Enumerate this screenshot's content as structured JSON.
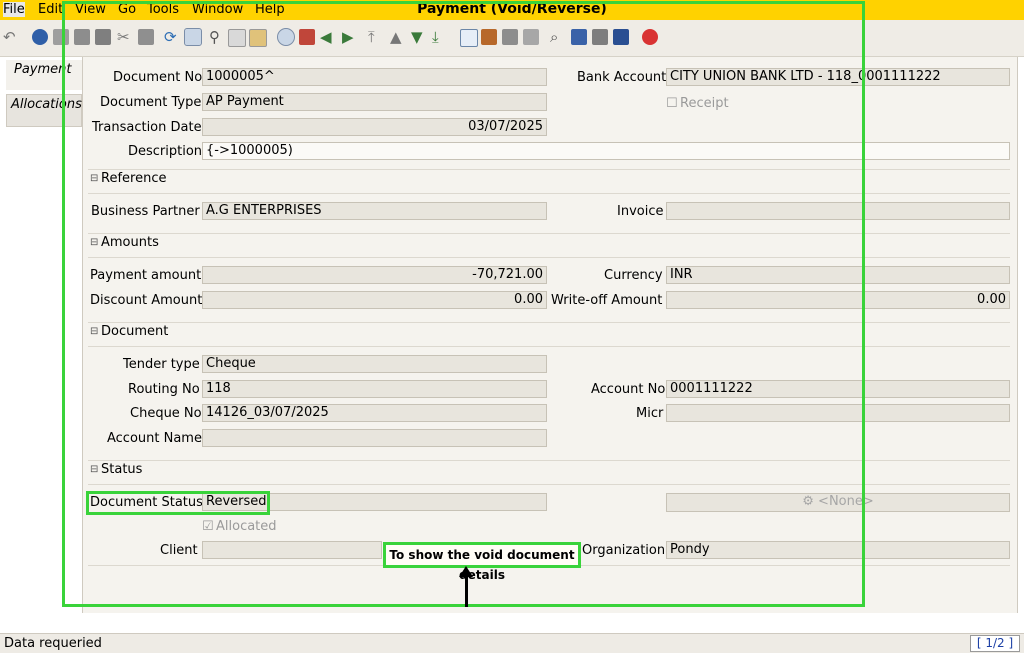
{
  "menu": {
    "file": "File",
    "edit": "Edit",
    "view": "View",
    "go": "Go",
    "tools": "Tools",
    "window": "Window",
    "help": "Help"
  },
  "window_title": "Payment (Void/Reverse)",
  "tabs": {
    "payment": "Payment",
    "allocations": "Allocations"
  },
  "fields": {
    "document_no": {
      "label": "Document No",
      "value": "1000005^"
    },
    "document_type": {
      "label": "Document Type",
      "value": "AP Payment"
    },
    "transaction_date": {
      "label": "Transaction Date",
      "value": "03/07/2025"
    },
    "description": {
      "label": "Description",
      "value": "{->1000005)"
    },
    "bank_account": {
      "label": "Bank Account",
      "value": "CITY UNION BANK LTD - 118_0001111222"
    },
    "receipt": {
      "label": "Receipt"
    }
  },
  "reference": {
    "title": "Reference",
    "business_partner": {
      "label": "Business Partner",
      "value": "A.G ENTERPRISES"
    },
    "invoice": {
      "label": "Invoice",
      "value": ""
    }
  },
  "amounts": {
    "title": "Amounts",
    "payment_amount": {
      "label": "Payment amount",
      "value": "-70,721.00"
    },
    "currency": {
      "label": "Currency",
      "value": "INR"
    },
    "discount_amount": {
      "label": "Discount Amount",
      "value": "0.00"
    },
    "writeoff_amount": {
      "label": "Write-off Amount",
      "value": "0.00"
    }
  },
  "document": {
    "title": "Document",
    "tender_type": {
      "label": "Tender type",
      "value": "Cheque"
    },
    "routing_no": {
      "label": "Routing No",
      "value": "118"
    },
    "account_no": {
      "label": "Account No",
      "value": "0001111222"
    },
    "cheque_no": {
      "label": "Cheque No",
      "value": "14126_03/07/2025"
    },
    "micr": {
      "label": "Micr",
      "value": ""
    },
    "account_name": {
      "label": "Account Name",
      "value": ""
    }
  },
  "status": {
    "title": "Status",
    "document_status": {
      "label": "Document Status",
      "value": "Reversed"
    },
    "none_button": "<None>",
    "allocated": {
      "label": "Allocated"
    },
    "client": {
      "label": "Client",
      "value": ""
    },
    "organization": {
      "label": "Organization",
      "value": "Pondy"
    }
  },
  "annotation": {
    "callout": "To show the void document details"
  },
  "statusbar": {
    "message": "Data requeried",
    "page": "[ 1/2 ]"
  },
  "colors": {
    "menubar": "#ffd200",
    "highlight": "#39d33a",
    "panel": "#f5f3ee"
  },
  "toolbar_icons": [
    "undo-icon",
    "help-icon",
    "new-icon",
    "copy-icon",
    "delete-icon",
    "cut-icon",
    "save-icon",
    "refresh-icon",
    "find-icon",
    "attachment-icon",
    "chat-icon",
    "grid-toggle-icon",
    "history-icon",
    "home-icon",
    "back-icon",
    "forward-icon",
    "first-record-icon",
    "previous-record-icon",
    "next-record-icon",
    "last-record-icon",
    "report-icon",
    "archive-icon",
    "print-preview-icon",
    "print-icon",
    "zoom-across-icon",
    "request-icon",
    "product-info-icon",
    "process-icon",
    "close-icon"
  ]
}
